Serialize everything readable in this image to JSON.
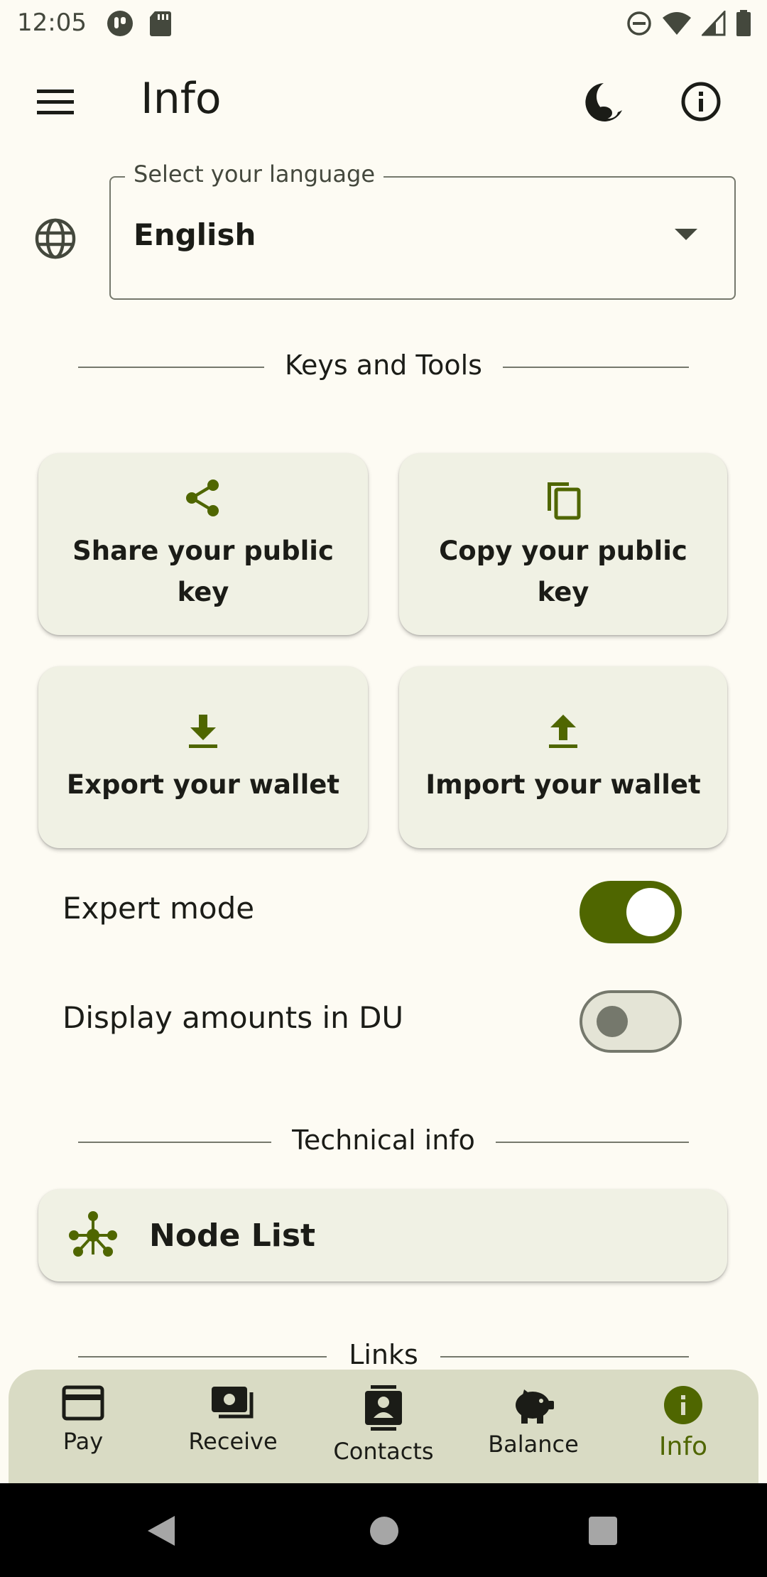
{
  "status_bar": {
    "time": "12:05"
  },
  "app_bar": {
    "title": "Info"
  },
  "language": {
    "legend": "Select your language",
    "value": "English"
  },
  "sections": {
    "keys_tools": "Keys and Tools",
    "technical": "Technical info",
    "links": "Links"
  },
  "cards": {
    "share": "Share your public key",
    "copy": "Copy your public key",
    "export": "Export your wallet",
    "import": "Import your wallet"
  },
  "settings": {
    "expert_mode": {
      "label": "Expert mode",
      "enabled": true
    },
    "display_du": {
      "label": "Display amounts in DU",
      "enabled": false
    }
  },
  "node_list": {
    "label": "Node List"
  },
  "bottom_nav": {
    "items": [
      {
        "label": "Pay",
        "icon": "credit-card-icon"
      },
      {
        "label": "Receive",
        "icon": "cash-icon"
      },
      {
        "label": "Contacts",
        "icon": "contact-card-icon"
      },
      {
        "label": "Balance",
        "icon": "piggy-bank-icon"
      },
      {
        "label": "Info",
        "icon": "info-filled-icon",
        "active": true
      }
    ]
  },
  "colors": {
    "accent": "#4f6600",
    "background": "#fdfbf3",
    "card": "#f0f1e4",
    "nav": "#d9dbc4"
  }
}
